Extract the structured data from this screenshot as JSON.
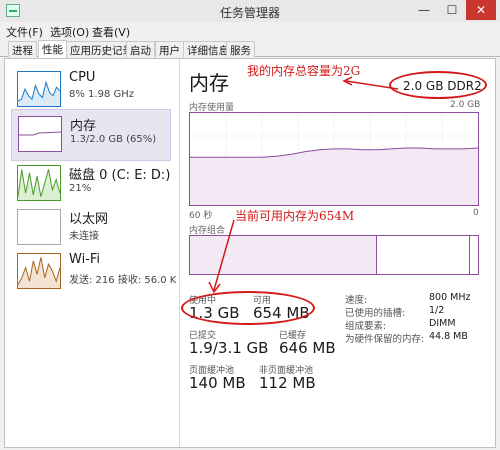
{
  "window": {
    "title": "任务管理器",
    "minimize": "—",
    "maximize": "☐",
    "close": "✕"
  },
  "menu": [
    "文件(F)",
    "选项(O)",
    "查看(V)"
  ],
  "tabs": [
    "进程",
    "性能",
    "应用历史记录",
    "启动",
    "用户",
    "详细信息",
    "服务"
  ],
  "active_tab": "性能",
  "sidebar": [
    {
      "name": "CPU",
      "detail": "8% 1.98 GHz"
    },
    {
      "name": "内存",
      "detail": "1.3/2.0 GB (65%)"
    },
    {
      "name": "磁盘 0 (C: E: D:)",
      "detail": "21%"
    },
    {
      "name": "以太网",
      "detail": "未连接"
    },
    {
      "name": "Wi-Fi",
      "detail": "发送: 216 接收: 56.0 K"
    }
  ],
  "main": {
    "title": "内存",
    "total": "2.0 GB DDR2",
    "usage_label": "内存使用量",
    "usage_max": "2.0 GB",
    "time_label": "60 秒",
    "time_end": "0",
    "composition_label": "内存组合",
    "in_use_fraction": 0.65
  },
  "stats": {
    "in_use_label": "使用中",
    "in_use": "1.3 GB",
    "available_label": "可用",
    "available": "654 MB",
    "committed_label": "已提交",
    "committed": "1.9/3.1 GB",
    "cached_label": "已缓存",
    "cached": "646 MB",
    "paged_label": "页面缓冲池",
    "paged": "140 MB",
    "nonpaged_label": "非页面缓冲池",
    "nonpaged": "112 MB"
  },
  "details": [
    {
      "key": "速度:",
      "value": "800 MHz"
    },
    {
      "key": "已使用的插槽:",
      "value": "1/2"
    },
    {
      "key": "组成要素:",
      "value": "DIMM"
    },
    {
      "key": "为硬件保留的内存:",
      "value": "44.8 MB"
    }
  ],
  "annotations": {
    "total_note": "我的内存总容量为2G",
    "available_note": "当前可用内存为654M"
  },
  "colors": {
    "memory": "#8c4d9b",
    "cpu": "#1b78c4",
    "disk": "#4a9a2a",
    "wifi": "#a5651e",
    "annotation": "#d41818"
  },
  "graphs": {
    "cpu_thumb": [
      0.15,
      0.2,
      0.5,
      0.3,
      0.2,
      0.6,
      0.35,
      0.25,
      0.7,
      0.4,
      0.3,
      0.55,
      0.45
    ],
    "mem_usage": [
      0.52,
      0.52,
      0.52,
      0.52,
      0.52,
      0.52,
      0.53,
      0.55,
      0.58,
      0.6,
      0.61,
      0.61,
      0.6,
      0.6,
      0.61,
      0.62,
      0.62,
      0.61,
      0.61,
      0.61,
      0.62
    ],
    "disk_thumb": [
      0.1,
      0.9,
      0.2,
      0.8,
      0.15,
      0.7,
      0.1,
      0.5,
      0.9,
      0.3,
      0.6,
      0.2
    ],
    "wifi_thumb": [
      0.1,
      0.3,
      0.6,
      0.2,
      0.8,
      0.4,
      0.9,
      0.3,
      0.7,
      0.5,
      0.2,
      0.6
    ]
  }
}
